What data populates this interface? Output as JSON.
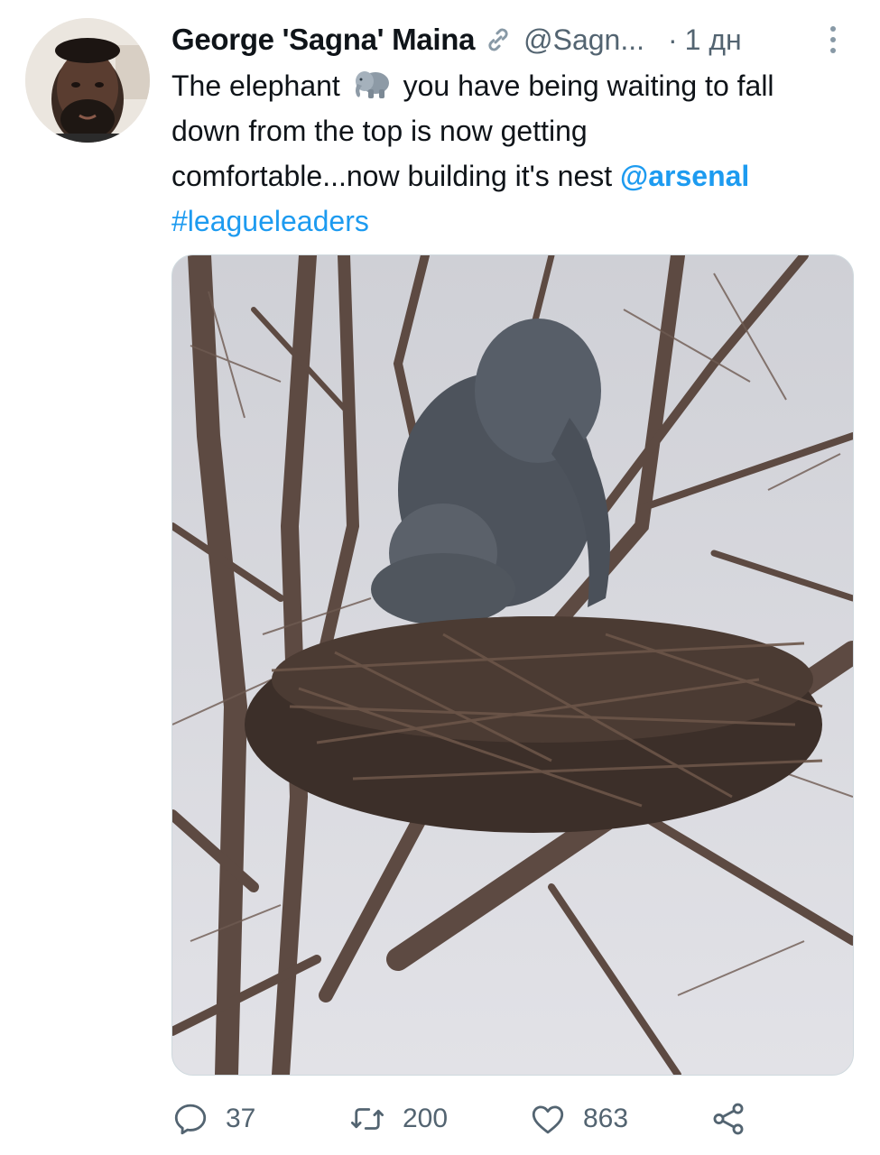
{
  "tweet": {
    "author_name": "George 'Sagna' Maina",
    "handle": "@Sagn...",
    "separator": "·",
    "time": "1 дн",
    "text": {
      "line1_before_emoji": "The elephant ",
      "line1_after_emoji": " you have being waiting to fall",
      "line2": "down from the top is now getting",
      "line3_before_mention": "comfortable...now building it's nest ",
      "mention": "@arsenal",
      "hashtag": "#leagueleaders"
    }
  },
  "icons": {
    "verified_link": "link-icon",
    "more": "more-vertical-icon",
    "emoji": "elephant-emoji",
    "reply": "reply-icon",
    "retweet": "retweet-icon",
    "like": "heart-icon",
    "share": "share-icon"
  },
  "actions": {
    "reply_count": "37",
    "retweet_count": "200",
    "like_count": "863"
  },
  "colors": {
    "link": "#1d9bf0",
    "secondary": "#536471",
    "text": "#0f1419"
  }
}
